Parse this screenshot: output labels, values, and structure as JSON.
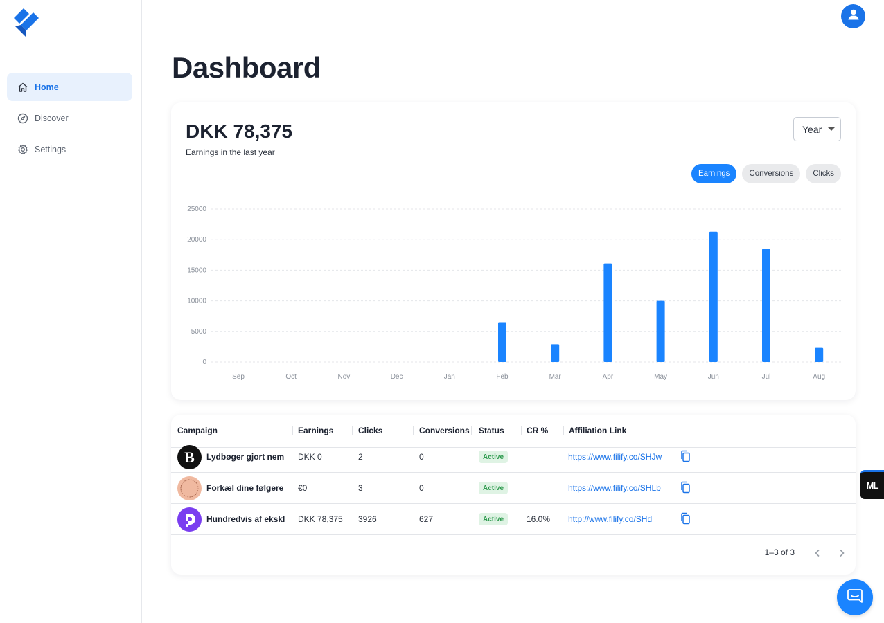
{
  "nav": {
    "items": [
      {
        "label": "Home",
        "icon": "home-icon",
        "active": true
      },
      {
        "label": "Discover",
        "icon": "compass-icon",
        "active": false
      },
      {
        "label": "Settings",
        "icon": "gear-icon",
        "active": false
      }
    ]
  },
  "header": {
    "title": "Dashboard"
  },
  "summary": {
    "total": "DKK 78,375",
    "caption": "Earnings in the last year",
    "period": "Year"
  },
  "metric_tabs": [
    {
      "label": "Earnings",
      "active": true
    },
    {
      "label": "Conversions",
      "active": false
    },
    {
      "label": "Clicks",
      "active": false
    }
  ],
  "colors": {
    "accent": "#1a84ff",
    "nav_active_bg": "#e8f1fd",
    "active_badge_bg": "#dff3e4",
    "active_badge_text": "#2e9a4e"
  },
  "chart_data": {
    "type": "bar",
    "categories": [
      "Sep",
      "Oct",
      "Nov",
      "Dec",
      "Jan",
      "Feb",
      "Mar",
      "Apr",
      "May",
      "Jun",
      "Jul",
      "Aug"
    ],
    "values": [
      0,
      0,
      0,
      0,
      0,
      6500,
      2900,
      16100,
      10000,
      21300,
      18500,
      2300
    ],
    "ylim": [
      0,
      25000
    ],
    "yticks": [
      "0",
      "5000",
      "10000",
      "15000",
      "20000",
      "25000"
    ],
    "grid": true,
    "color": "#1a84ff"
  },
  "table": {
    "columns": [
      "Campaign",
      "Earnings",
      "Clicks",
      "Conversions",
      "Status",
      "CR %",
      "Affiliation Link"
    ],
    "rows": [
      {
        "campaign": "Lydbøger gjort nem",
        "earnings": "DKK 0",
        "clicks": "2",
        "conversions": "0",
        "status": "Active",
        "cr": "",
        "link": "https://www.filify.co/SHJw",
        "logo": "b-logo"
      },
      {
        "campaign": "Forkæl dine følgere",
        "earnings": "€0",
        "clicks": "3",
        "conversions": "0",
        "status": "Active",
        "cr": "",
        "link": "https://www.filify.co/SHLb",
        "logo": "circle-stamp-logo"
      },
      {
        "campaign": "Hundredvis af ekskl",
        "earnings": "DKK 78,375",
        "clicks": "3926",
        "conversions": "627",
        "status": "Active",
        "cr": "16.0%",
        "link": "http://www.filify.co/SHd",
        "logo": "purple-logo"
      }
    ],
    "pagination": "1–3 of 3"
  },
  "widget": {
    "label": "ML"
  }
}
